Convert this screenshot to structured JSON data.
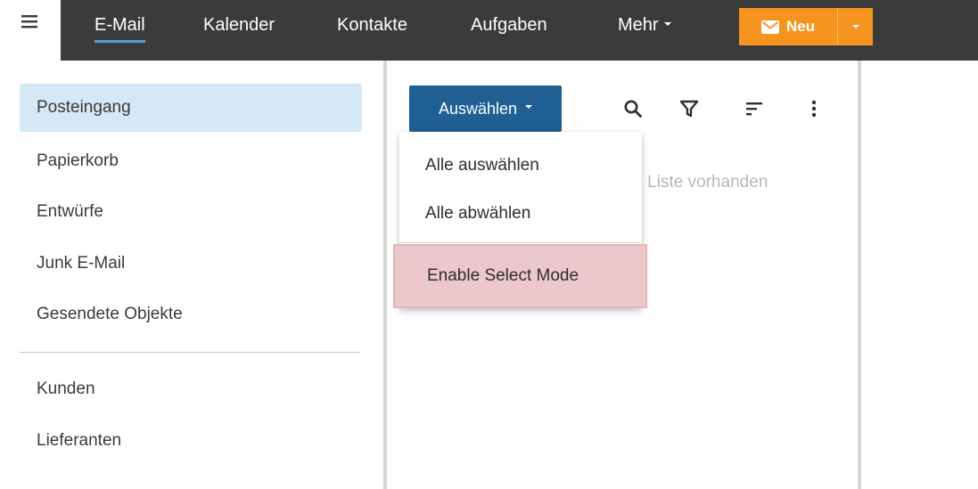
{
  "topbar": {
    "nav": [
      {
        "label": "E-Mail",
        "active": true
      },
      {
        "label": "Kalender"
      },
      {
        "label": "Kontakte"
      },
      {
        "label": "Aufgaben"
      },
      {
        "label": "Mehr"
      }
    ],
    "new_button_label": "Neu",
    "accent_color": "#f5941e"
  },
  "sidebar": {
    "folders": [
      {
        "label": "Posteingang",
        "selected": true
      },
      {
        "label": "Papierkorb"
      },
      {
        "label": "Entwürfe"
      },
      {
        "label": "Junk E-Mail"
      },
      {
        "label": "Gesendete Objekte"
      }
    ],
    "custom_folders": [
      {
        "label": "Kunden"
      },
      {
        "label": "Lieferanten"
      }
    ]
  },
  "list": {
    "select_button_label": "Auswählen",
    "empty_text": "er Liste vorhanden",
    "toolbar_icons": [
      "search-icon",
      "filter-icon",
      "sort-icon",
      "more-vertical-icon"
    ]
  },
  "select_menu": {
    "items": [
      {
        "label": "Alle auswählen"
      },
      {
        "label": "Alle abwählen"
      },
      {
        "label": "Enable Select Mode",
        "highlighted": true
      }
    ]
  }
}
